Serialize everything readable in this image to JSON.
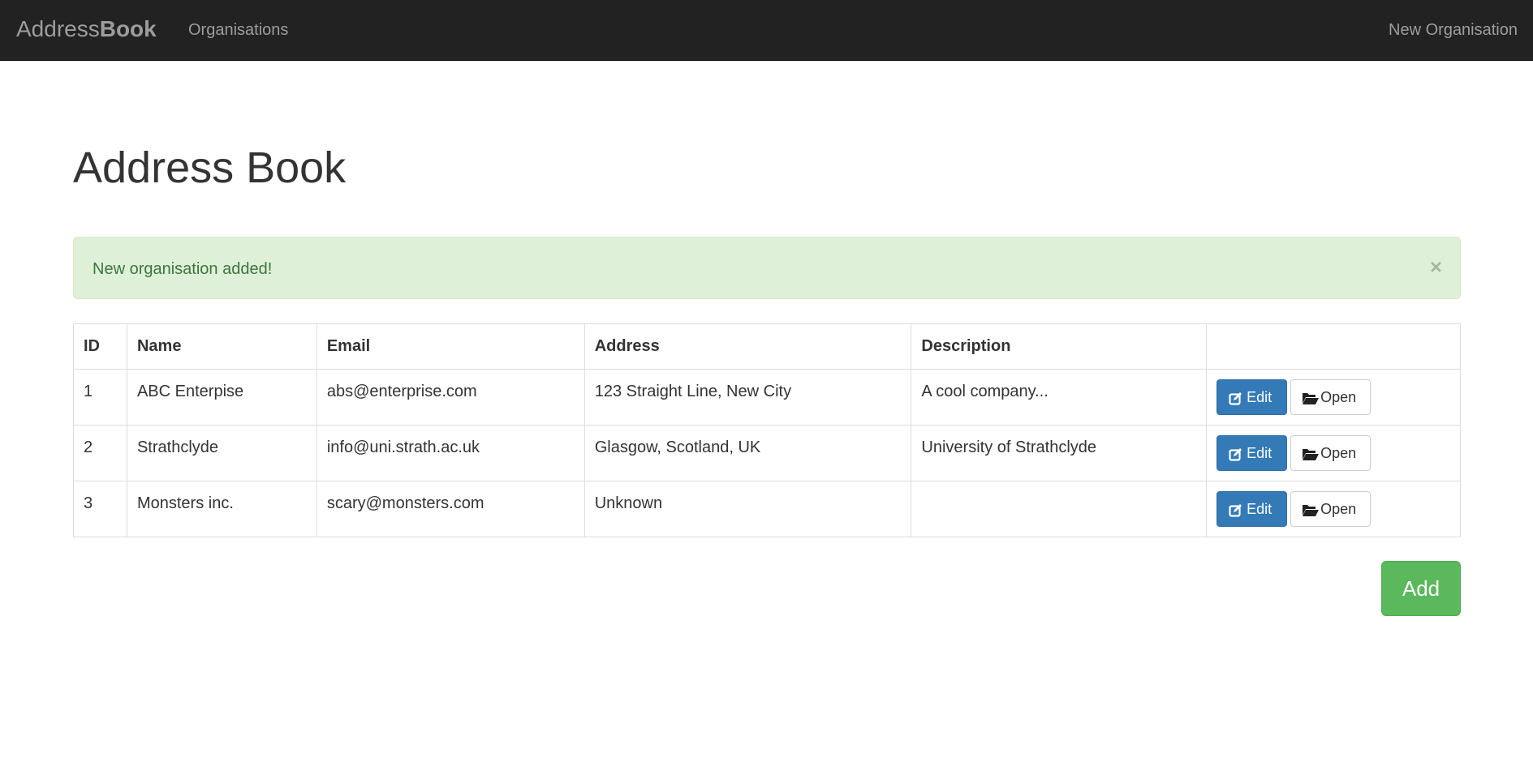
{
  "navbar": {
    "brand_light": "Address",
    "brand_bold": "Book",
    "organisations_label": "Organisations",
    "new_organisation_label": "New Organisation"
  },
  "page": {
    "title": "Address Book"
  },
  "alert": {
    "message": "New organisation added!",
    "close_glyph": "×"
  },
  "table": {
    "headers": [
      "ID",
      "Name",
      "Email",
      "Address",
      "Description",
      ""
    ],
    "rows": [
      {
        "id": "1",
        "name": "ABC Enterpise",
        "email": "abs@enterprise.com",
        "address": "123 Straight Line, New City",
        "description": "A cool company..."
      },
      {
        "id": "2",
        "name": "Strathclyde",
        "email": "info@uni.strath.ac.uk",
        "address": "Glasgow, Scotland, UK",
        "description": "University of Strathclyde"
      },
      {
        "id": "3",
        "name": "Monsters inc.",
        "email": "scary@monsters.com",
        "address": "Unknown",
        "description": ""
      }
    ],
    "edit_label": "Edit",
    "open_label": "Open"
  },
  "add_button": {
    "label": "Add"
  },
  "colors": {
    "navbar_bg": "#222222",
    "alert_bg": "#dff0d8",
    "alert_text": "#3c763d",
    "primary": "#337ab7",
    "success": "#5cb85c"
  },
  "icons": {
    "edit": "edit-icon",
    "open": "folder-open-icon"
  }
}
